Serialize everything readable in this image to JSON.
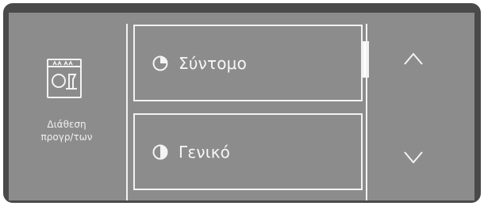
{
  "screen": {
    "left_panel": {
      "icon": "dishwasher-program-icon",
      "label_line_1": "Διάθεση",
      "label_line_2": "προγρ/των"
    },
    "programs": [
      {
        "label": "Σύντομο",
        "icon": "quarter-pie-icon",
        "selected": true
      },
      {
        "label": "Γενικό",
        "icon": "half-pie-icon",
        "selected": false
      }
    ],
    "navigation": {
      "up_icon": "chevron-up-icon",
      "down_icon": "chevron-down-icon"
    }
  },
  "colors": {
    "bezel": "#4a4a4a",
    "screen": "#8c8c8c",
    "foreground": "#f2f2f2"
  }
}
